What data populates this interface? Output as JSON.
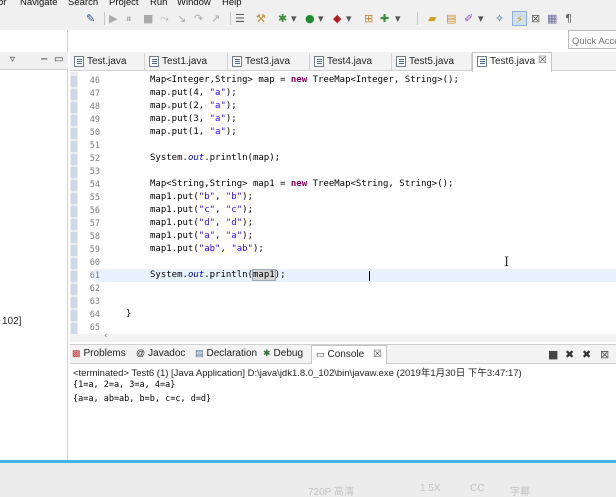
{
  "menubar": {
    "items": [
      "or",
      "Navigate",
      "Search",
      "Project",
      "Run",
      "Window",
      "Help"
    ]
  },
  "quick_access": {
    "placeholder": "Quick Access"
  },
  "left_panel": {
    "label": "102]"
  },
  "editor_tabs": [
    {
      "label": "Test.java",
      "active": false
    },
    {
      "label": "Test1.java",
      "active": false
    },
    {
      "label": "Test3.java",
      "active": false
    },
    {
      "label": "Test4.java",
      "active": false
    },
    {
      "label": "Test5.java",
      "active": false
    },
    {
      "label": "Test6.java",
      "active": true
    }
  ],
  "editor": {
    "lines": [
      {
        "num": "46",
        "text": "Map<Integer,String> map = new TreeMap<Integer, String>();"
      },
      {
        "num": "47",
        "text": "map.put(4, \"a\");"
      },
      {
        "num": "48",
        "text": "map.put(2, \"a\");"
      },
      {
        "num": "49",
        "text": "map.put(3, \"a\");"
      },
      {
        "num": "50",
        "text": "map.put(1, \"a\");"
      },
      {
        "num": "51",
        "text": ""
      },
      {
        "num": "52",
        "text": "System.out.println(map);"
      },
      {
        "num": "53",
        "text": ""
      },
      {
        "num": "54",
        "text": "Map<String,String> map1 = new TreeMap<String, String>();"
      },
      {
        "num": "55",
        "text": "map1.put(\"b\", \"b\");"
      },
      {
        "num": "56",
        "text": "map1.put(\"c\", \"c\");"
      },
      {
        "num": "57",
        "text": "map1.put(\"d\", \"d\");"
      },
      {
        "num": "58",
        "text": "map1.put(\"a\", \"a\");"
      },
      {
        "num": "59",
        "text": "map1.put(\"ab\", \"ab\");"
      },
      {
        "num": "60",
        "text": ""
      },
      {
        "num": "61",
        "text": "System.out.println(map1);"
      },
      {
        "num": "62",
        "text": ""
      },
      {
        "num": "63",
        "text": ""
      },
      {
        "num": "64",
        "text": "}"
      },
      {
        "num": "65",
        "text": ""
      }
    ],
    "current_line": "61"
  },
  "bottom_tabs": [
    {
      "label": "Problems",
      "icon": "problems-icon",
      "active": false
    },
    {
      "label": "Javadoc",
      "icon": "at-icon",
      "active": false
    },
    {
      "label": "Declaration",
      "icon": "declaration-icon",
      "active": false
    },
    {
      "label": "Debug",
      "icon": "bug-icon",
      "active": false
    },
    {
      "label": "Console",
      "icon": "console-icon",
      "active": true
    }
  ],
  "console": {
    "header": "<terminated> Test6 (1) [Java Application] D:\\java\\jdk1.8.0_102\\bin\\javaw.exe (2019年1月30日 下午3:47:17)",
    "output": [
      "{1=a, 2=a, 3=a, 4=a}",
      "{a=a, ab=ab, b=b, c=c, d=d}"
    ]
  },
  "player": {
    "items": [
      "720P 高清",
      "1.5X",
      "CC",
      "字幕"
    ]
  },
  "colors": {
    "keyword": "#7f0055",
    "string": "#2a00ff",
    "field": "#0000c0",
    "current_line": "#e8f2fe",
    "player_accent": "#3fb5e8"
  }
}
